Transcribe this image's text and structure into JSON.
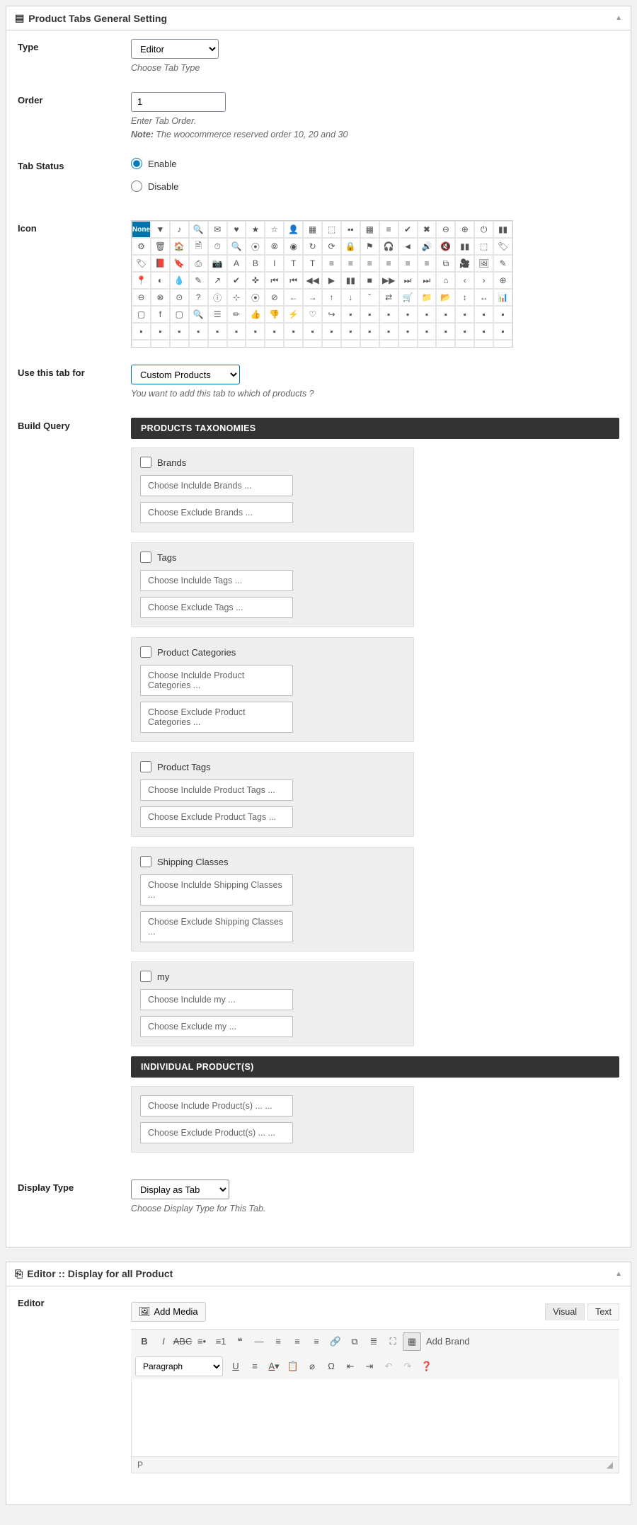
{
  "panel1": {
    "title": "Product Tabs General Setting",
    "type": {
      "label": "Type",
      "value": "Editor",
      "desc": "Choose Tab Type"
    },
    "order": {
      "label": "Order",
      "value": "1",
      "desc": "Enter Tab Order.",
      "note_prefix": "Note:",
      "note_text": " The woocommerce reserved order 10, 20 and 30"
    },
    "status": {
      "label": "Tab Status",
      "opt1": "Enable",
      "opt2": "Disable"
    },
    "icon": {
      "label": "Icon",
      "none": "None"
    },
    "use_for": {
      "label": "Use this tab for",
      "value": "Custom Products",
      "desc": "You want to add this tab to which of products ?"
    },
    "build_query": {
      "label": "Build Query"
    },
    "tax_header": "PRODUCTS TAXONOMIES",
    "ind_header": "INDIVIDUAL PRODUCT(S)",
    "taxonomies": [
      {
        "name": "Brands",
        "inc": "Choose Inclulde  Brands ...",
        "exc": "Choose Exclude Brands ..."
      },
      {
        "name": "Tags",
        "inc": "Choose Inclulde  Tags ...",
        "exc": "Choose Exclude Tags ..."
      },
      {
        "name": "Product Categories",
        "inc": "Choose Inclulde  Product Categories ...",
        "exc": "Choose Exclude Product Categories ..."
      },
      {
        "name": "Product Tags",
        "inc": "Choose Inclulde  Product Tags ...",
        "exc": "Choose Exclude Product Tags ..."
      },
      {
        "name": "Shipping Classes",
        "inc": "Choose Inclulde  Shipping Classes ...",
        "exc": "Choose Exclude Shipping Classes ..."
      },
      {
        "name": "my",
        "inc": "Choose Inclulde  my ...",
        "exc": "Choose Exclude my ..."
      }
    ],
    "individual": {
      "inc": "Choose Include Product(s) ... ...",
      "exc": "Choose Exclude Product(s) ... ..."
    },
    "display_type": {
      "label": "Display Type",
      "value": "Display as Tab",
      "desc": "Choose Display Type for This Tab."
    }
  },
  "panel2": {
    "title": "Editor :: Display for all Product",
    "label": "Editor",
    "add_media": "Add Media",
    "visual": "Visual",
    "text": "Text",
    "paragraph": "Paragraph",
    "add_brand": "Add Brand",
    "status_path": "P"
  },
  "icons_glyphs": [
    "",
    "▼",
    "♪",
    "🔍",
    "✉",
    "♥",
    "★",
    "☆",
    "👤",
    "▦",
    "⬚",
    "▪▪",
    "▦",
    "≡",
    "✔",
    "✖",
    "⊖",
    "⊕",
    "⏻",
    "▮▮",
    "⚙",
    "🗑",
    "🏠",
    "🗎",
    "⏱",
    "🔍",
    "⦿",
    "⦾",
    "◉",
    "↻",
    "⟳",
    "🔒",
    "⚑",
    "🎧",
    "◄",
    "🔊",
    "🔇",
    "▮▮",
    "⬚",
    "🏷",
    "🏷",
    "📕",
    "🔖",
    "⎙",
    "📷",
    "A",
    "B",
    "I",
    "T",
    "T",
    "≡",
    "≡",
    "≡",
    "≡",
    "≡",
    "≡",
    "⧉",
    "🎥",
    "🖼",
    "✎",
    "📍",
    "◐",
    "💧",
    "✎",
    "↗",
    "✔",
    "✜",
    "⏮",
    "⏮",
    "◀◀",
    "▶",
    "▮▮",
    "■",
    "▶▶",
    "⏭",
    "⏭",
    "⌂",
    "‹",
    "›",
    "⊕",
    "⊖",
    "⊗",
    "⊙",
    "?",
    "ⓘ",
    "⊹",
    "⦿",
    "⊘",
    "←",
    "→",
    "↑",
    "↓",
    "ˇ",
    "⇄",
    "🛒",
    "📁",
    "📂",
    "↕",
    "↔",
    "📊",
    "▢",
    "f",
    "▢",
    "🔍",
    "☰",
    "✏",
    "👍",
    "👎",
    "⚡",
    "♡",
    "↪"
  ]
}
